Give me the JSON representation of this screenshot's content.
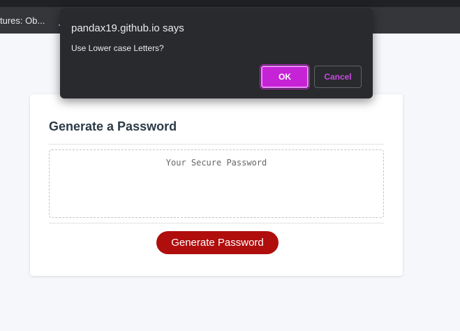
{
  "browser": {
    "bookmark_bar": {
      "items": [
        {
          "label": "tures: Ob...",
          "icon": "none"
        },
        {
          "label": "",
          "icon": "laptop-icon"
        }
      ]
    }
  },
  "card": {
    "title": "Generate a Password",
    "password_placeholder": "Your Secure Password",
    "password_value": "",
    "generate_button_label": "Generate Password"
  },
  "dialog": {
    "title": "pandax19.github.io says",
    "message": "Use Lower case Letters?",
    "ok_label": "OK",
    "cancel_label": "Cancel"
  },
  "colors": {
    "page_background": "#f6f7fb",
    "generate_button": "#b00d0d",
    "dialog_background": "#292a2d",
    "ok_button": "#c623d6",
    "cancel_text": "#c54be0",
    "title_text": "#2c3a47"
  }
}
